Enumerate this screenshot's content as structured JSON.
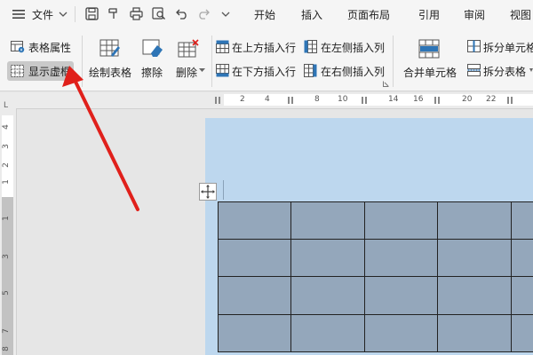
{
  "menu": {
    "file_label": "文件",
    "tabs": [
      "开始",
      "插入",
      "页面布局",
      "引用",
      "审阅",
      "视图"
    ]
  },
  "ribbon": {
    "table_properties": "表格属性",
    "show_gridlines": "显示虚框",
    "draw_table": "绘制表格",
    "eraser": "擦除",
    "delete": "删除",
    "insert_row_above": "在上方插入行",
    "insert_row_below": "在下方插入行",
    "insert_col_left": "在左侧插入列",
    "insert_col_right": "在右侧插入列",
    "merge_cells": "合并单元格",
    "split_cells": "拆分单元格",
    "split_table": "拆分表格"
  },
  "ruler": {
    "horizontal": [
      "2",
      "4",
      "8",
      "10",
      "14",
      "16",
      "20",
      "22"
    ],
    "vertical": [
      "4",
      "3",
      "2",
      "1",
      "1",
      "3",
      "5",
      "7",
      "8"
    ]
  },
  "colors": {
    "annotation_arrow": "#e0201b",
    "table_cell": "#94a7bb",
    "page_shading": "#bdd7ee"
  },
  "icons": [
    "hamburger-icon",
    "chevron-down-icon",
    "save-icon",
    "format-painter-icon",
    "print-icon",
    "print-preview-icon",
    "undo-icon",
    "redo-icon",
    "table-move-handle-icon"
  ]
}
